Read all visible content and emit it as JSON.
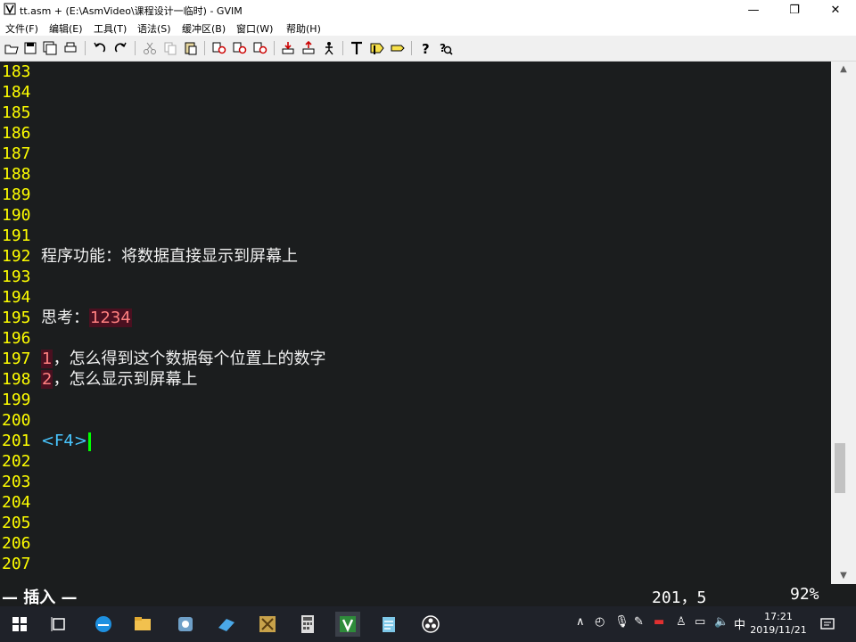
{
  "window": {
    "title": "tt.asm + (E:\\AsmVideo\\课程设计一临时) - GVIM",
    "controls": {
      "minimize": "—",
      "maximize": "❐",
      "close": "✕"
    }
  },
  "menu": [
    {
      "label": "文件(F)"
    },
    {
      "label": "编辑(E)"
    },
    {
      "label": "工具(T)"
    },
    {
      "label": "语法(S)"
    },
    {
      "label": "缓冲区(B)"
    },
    {
      "label": "窗口(W)"
    },
    {
      "label": "帮助(H)"
    }
  ],
  "toolbar": [
    "open-icon",
    "save-icon",
    "save-all-icon",
    "print-icon",
    "undo-icon",
    "redo-icon",
    "cut-icon",
    "copy-icon",
    "paste-icon",
    "find-replace-icon",
    "find-next-icon",
    "find-prev-icon",
    "load-session-icon",
    "save-session-icon",
    "run-script-icon",
    "make-icon",
    "run-ctags-icon",
    "jump-tag-icon",
    "help-icon",
    "find-help-icon"
  ],
  "editor": {
    "lines": [
      {
        "num": "183",
        "text": ""
      },
      {
        "num": "184",
        "text": ""
      },
      {
        "num": "185",
        "text": ""
      },
      {
        "num": "186",
        "text": ""
      },
      {
        "num": "187",
        "text": ""
      },
      {
        "num": "188",
        "text": ""
      },
      {
        "num": "189",
        "text": ""
      },
      {
        "num": "190",
        "text": ""
      },
      {
        "num": "191",
        "text": ""
      },
      {
        "num": "192",
        "text": "程序功能：将数据直接显示到屏幕上"
      },
      {
        "num": "193",
        "text": ""
      },
      {
        "num": "194",
        "text": ""
      },
      {
        "num": "195",
        "text": "思考：",
        "highlight": "1234"
      },
      {
        "num": "196",
        "text": ""
      },
      {
        "num": "197",
        "lead": "1",
        "text": "，怎么得到这个数据每个位置上的数字"
      },
      {
        "num": "198",
        "lead": "2",
        "text": "，怎么显示到屏幕上"
      },
      {
        "num": "199",
        "text": ""
      },
      {
        "num": "200",
        "text": ""
      },
      {
        "num": "201",
        "tag": "<F4>",
        "cursor": true
      },
      {
        "num": "202",
        "text": ""
      },
      {
        "num": "203",
        "text": ""
      },
      {
        "num": "204",
        "text": ""
      },
      {
        "num": "205",
        "text": ""
      },
      {
        "num": "206",
        "text": ""
      },
      {
        "num": "207",
        "text": ""
      }
    ]
  },
  "status": {
    "mode": "— 插入 —",
    "position": "201，5",
    "percent": "92%"
  },
  "taskbar": {
    "apps": [
      "windows-start-icon",
      "task-view-icon",
      "edge-icon",
      "file-explorer-icon",
      "app-icon-1",
      "app-icon-2",
      "app-icon-3",
      "calculator-icon",
      "gvim-icon",
      "notepad-icon",
      "obs-icon"
    ],
    "tray": {
      "ime": "中",
      "time": "17:21",
      "date": "2019/11/21"
    }
  }
}
